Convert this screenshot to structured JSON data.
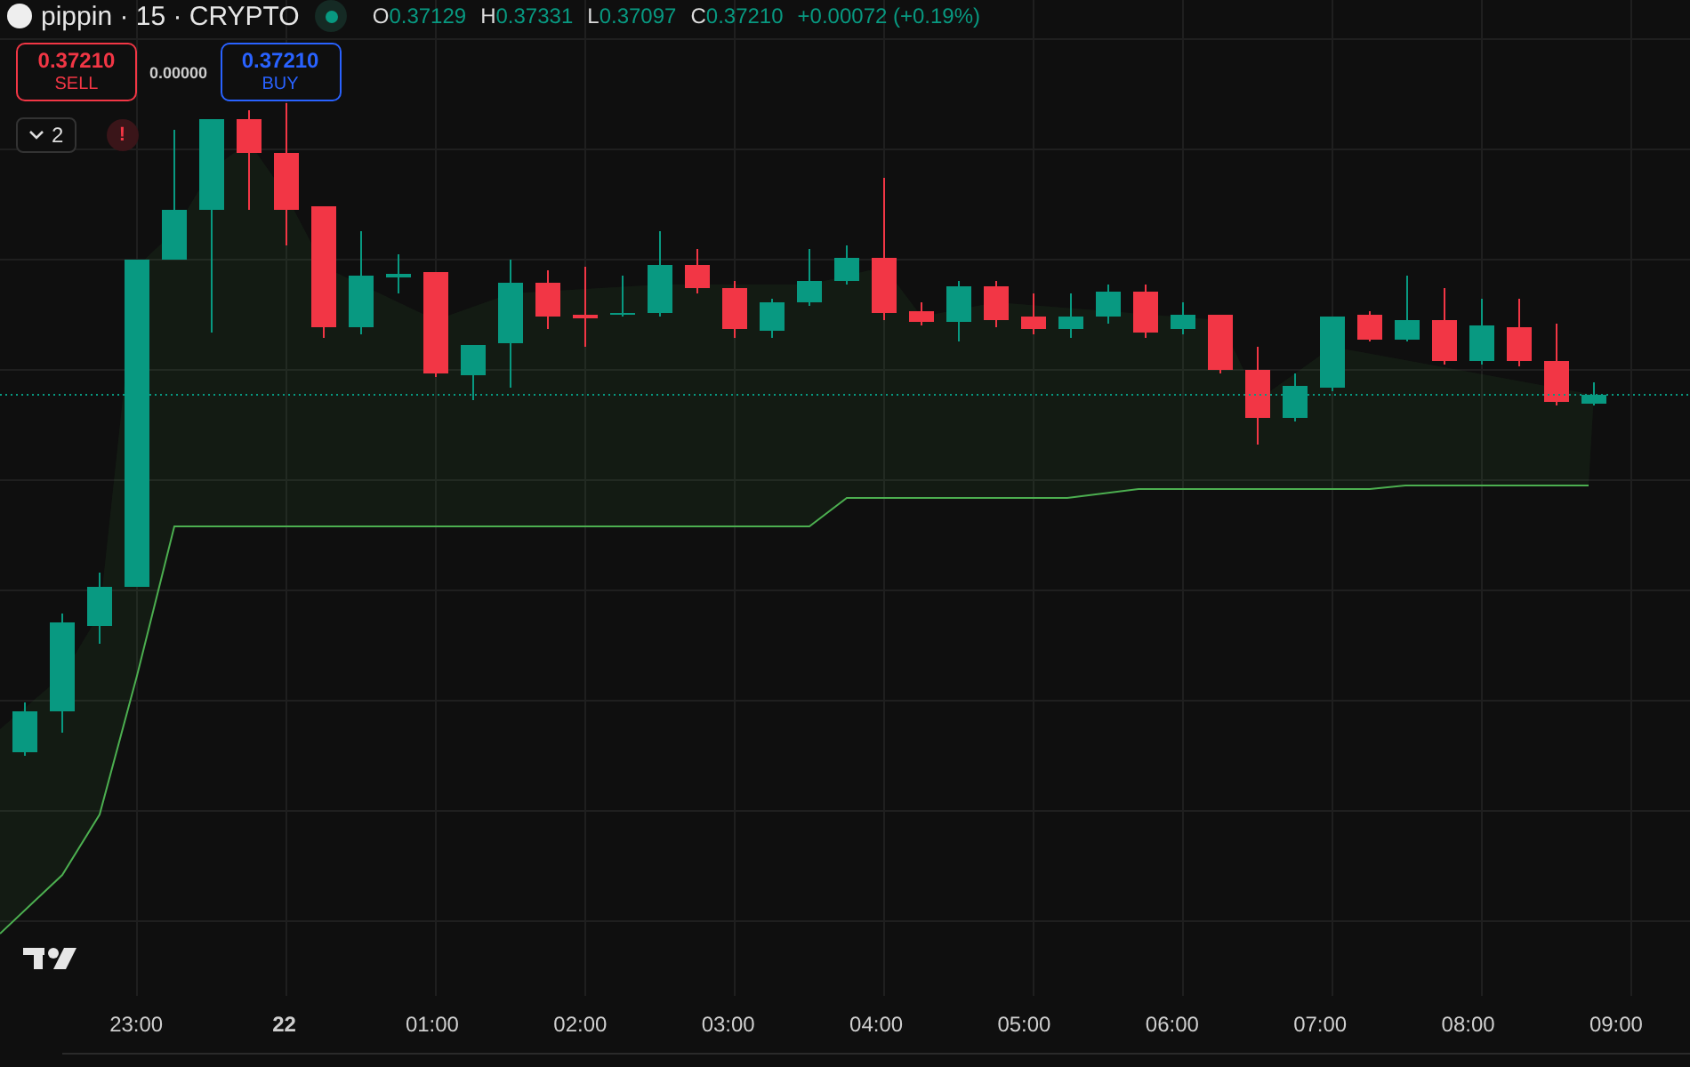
{
  "symbol": {
    "name": "pippin · 15 · CRYPTO",
    "market_open": true
  },
  "ohlc": [
    {
      "label": "O",
      "value": "0.37129"
    },
    {
      "label": "H",
      "value": "0.37331"
    },
    {
      "label": "L",
      "value": "0.37097"
    },
    {
      "label": "C",
      "value": "0.37210"
    }
  ],
  "change": "+0.00072 (+0.19%)",
  "trade": {
    "sell_price": "0.37210",
    "sell_label": "SELL",
    "spread": "0.00000",
    "buy_price": "0.37210",
    "buy_label": "BUY"
  },
  "indicators": {
    "count": "2",
    "alert": "!"
  },
  "time_axis": [
    {
      "label": "23:00",
      "kind": "time"
    },
    {
      "label": "22",
      "kind": "day"
    },
    {
      "label": "01:00",
      "kind": "time"
    },
    {
      "label": "02:00",
      "kind": "time"
    },
    {
      "label": "03:00",
      "kind": "time"
    },
    {
      "label": "04:00",
      "kind": "time"
    },
    {
      "label": "05:00",
      "kind": "time"
    },
    {
      "label": "06:00",
      "kind": "time"
    },
    {
      "label": "07:00",
      "kind": "time"
    },
    {
      "label": "08:00",
      "kind": "time"
    },
    {
      "label": "09:00",
      "kind": "time"
    }
  ]
}
